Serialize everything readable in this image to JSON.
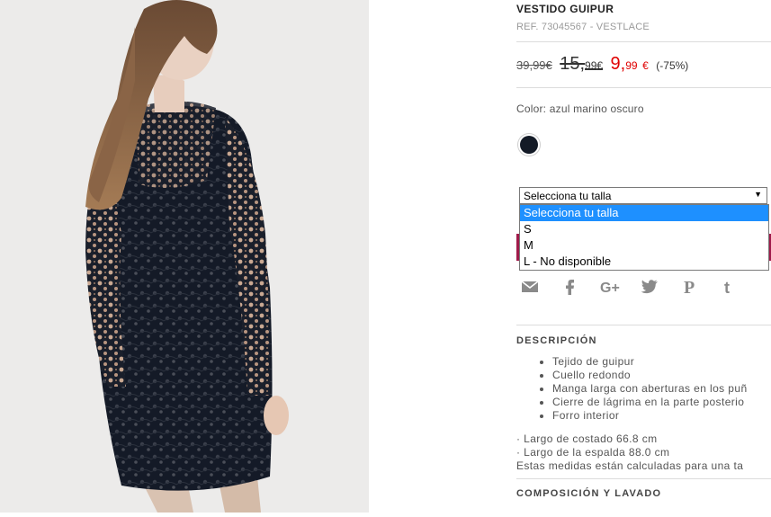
{
  "product": {
    "title": "VESTIDO GUIPUR",
    "ref": "REF. 73045567 - VESTLACE",
    "price_original_int": "39,99",
    "price_original_cur": "€",
    "price_previous_int": "15,",
    "price_previous_dec": "99",
    "price_previous_cur": "€",
    "price_sale_int": "9,",
    "price_sale_dec": "99",
    "price_sale_cur": "€",
    "discount": "(-75%)",
    "color_label": "Color: azul marino oscuro",
    "swatch_color": "#131a26",
    "sale_color": "#e00000",
    "add_button_color": "#a01a4a"
  },
  "size_select": {
    "value": "Selecciona tu talla",
    "arrow": "▼",
    "options": [
      "Selecciona tu talla",
      "S",
      "M",
      "L - No disponible"
    ],
    "highlighted_index": 0
  },
  "share": {
    "icons": [
      "email-icon",
      "facebook-icon",
      "google-plus-icon",
      "twitter-icon",
      "pinterest-icon",
      "tumblr-icon"
    ]
  },
  "description": {
    "title": "DESCRIPCIÓN",
    "bullets": [
      "Tejido de guipur",
      "Cuello redondo",
      "Manga larga con aberturas en los puñ",
      "Cierre de lágrima en la parte posterio",
      "Forro interior"
    ],
    "measures": [
      "· Largo de costado 66.8 cm",
      "· Largo de la espalda 88.0 cm",
      "Estas medidas están calculadas para una ta"
    ]
  },
  "composition": {
    "title": "COMPOSICIÓN Y LAVADO"
  }
}
